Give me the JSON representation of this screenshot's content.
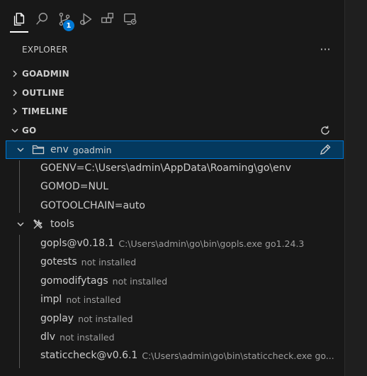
{
  "activity_bar": {
    "items": [
      {
        "name": "explorer",
        "icon": "files-icon",
        "active": true
      },
      {
        "name": "search",
        "icon": "search-icon"
      },
      {
        "name": "source-control",
        "icon": "source-control-icon",
        "badge": "1"
      },
      {
        "name": "run-debug",
        "icon": "run-debug-icon"
      },
      {
        "name": "extensions",
        "icon": "extensions-icon"
      },
      {
        "name": "remote-explorer",
        "icon": "remote-explorer-icon"
      }
    ]
  },
  "sidebar": {
    "title": "EXPLORER",
    "more_label": "···",
    "sections": [
      {
        "label": "GOADMIN",
        "expanded": false
      },
      {
        "label": "OUTLINE",
        "expanded": false
      },
      {
        "label": "TIMELINE",
        "expanded": false
      },
      {
        "label": "GO",
        "expanded": true
      }
    ]
  },
  "go_view": {
    "env": {
      "label": "env",
      "description": "goadmin"
    },
    "env_items": [
      "GOENV=C:\\Users\\admin\\AppData\\Roaming\\go\\env",
      "GOMOD=NUL",
      "GOTOOLCHAIN=auto"
    ],
    "tools": {
      "label": "tools"
    },
    "tool_items": [
      {
        "name": "gopls@v0.18.1",
        "desc": "C:\\Users\\admin\\go\\bin\\gopls.exe go1.24.3"
      },
      {
        "name": "gotests",
        "desc": "not installed"
      },
      {
        "name": "gomodifytags",
        "desc": "not installed"
      },
      {
        "name": "impl",
        "desc": "not installed"
      },
      {
        "name": "goplay",
        "desc": "not installed"
      },
      {
        "name": "dlv",
        "desc": "not installed"
      },
      {
        "name": "staticcheck@v0.6.1",
        "desc": "C:\\Users\\admin\\go\\bin\\staticcheck.exe go..."
      }
    ]
  },
  "colors": {
    "background": "#181818",
    "selection_bg": "#04395e",
    "focus_border": "#0078d4",
    "badge": "#0078d4",
    "text": "#cccccc",
    "description": "#9d9d9d"
  }
}
